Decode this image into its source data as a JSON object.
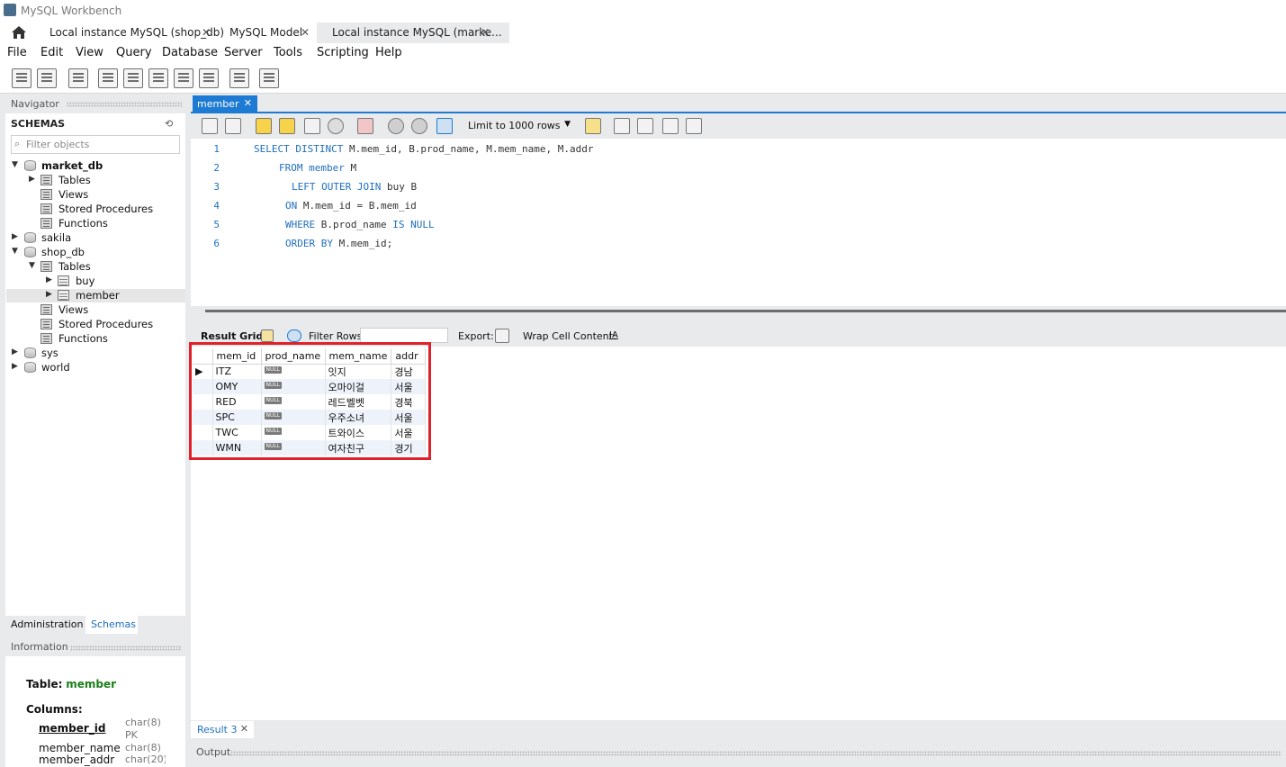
{
  "window": {
    "title": "MySQL Workbench"
  },
  "connection_tabs": [
    {
      "label": "Local instance MySQL (shop_db)"
    },
    {
      "label": "MySQL Model"
    },
    {
      "label": "Local instance MySQL (marke..."
    }
  ],
  "menu": [
    "File",
    "Edit",
    "View",
    "Query",
    "Database",
    "Server",
    "Tools",
    "Scripting",
    "Help"
  ],
  "navigator": {
    "header": "Navigator",
    "schemas_title": "SCHEMAS",
    "filter_placeholder": "Filter objects",
    "tree": {
      "market_db": "market_db",
      "market_tables": "Tables",
      "market_views": "Views",
      "market_procs": "Stored Procedures",
      "market_funcs": "Functions",
      "sakila": "sakila",
      "shop_db": "shop_db",
      "shop_tables": "Tables",
      "buy": "buy",
      "member": "member",
      "shop_views": "Views",
      "shop_procs": "Stored Procedures",
      "shop_funcs": "Functions",
      "sys": "sys",
      "world": "world"
    },
    "tabs": {
      "administration": "Administration",
      "schemas": "Schemas"
    }
  },
  "information": {
    "header": "Information",
    "table_label": "Table:",
    "table_name": "member",
    "columns_label": "Columns:",
    "columns": [
      {
        "name": "member_id",
        "type": "char(8)",
        "extra": "PK"
      },
      {
        "name": "member_name",
        "type": "char(8)"
      },
      {
        "name": "member_addr",
        "type": "char(20)"
      }
    ]
  },
  "editor": {
    "tab_label": "member",
    "limit_label": "Limit to 1000 rows",
    "line_numbers": [
      "1",
      "2",
      "3",
      "4",
      "5",
      "6"
    ]
  },
  "result": {
    "grid_label": "Result Grid",
    "filter_label": "Filter Rows:",
    "export_label": "Export:",
    "wrap_label": "Wrap Cell Content:",
    "columns": [
      "mem_id",
      "prod_name",
      "mem_name",
      "addr"
    ],
    "rows": [
      [
        "ITZ",
        "NULL",
        "잇지",
        "경남"
      ],
      [
        "OMY",
        "NULL",
        "오마이걸",
        "서울"
      ],
      [
        "RED",
        "NULL",
        "레드벨벳",
        "경북"
      ],
      [
        "SPC",
        "NULL",
        "우주소녀",
        "서울"
      ],
      [
        "TWC",
        "NULL",
        "트와이스",
        "서울"
      ],
      [
        "WMN",
        "NULL",
        "여자친구",
        "경기"
      ]
    ],
    "tab_label": "Result 3",
    "output_label": "Output"
  },
  "colors": {
    "accent": "#1e7bd3",
    "highlight_box": "#e0202a",
    "keyword": "#1e6fbf"
  }
}
